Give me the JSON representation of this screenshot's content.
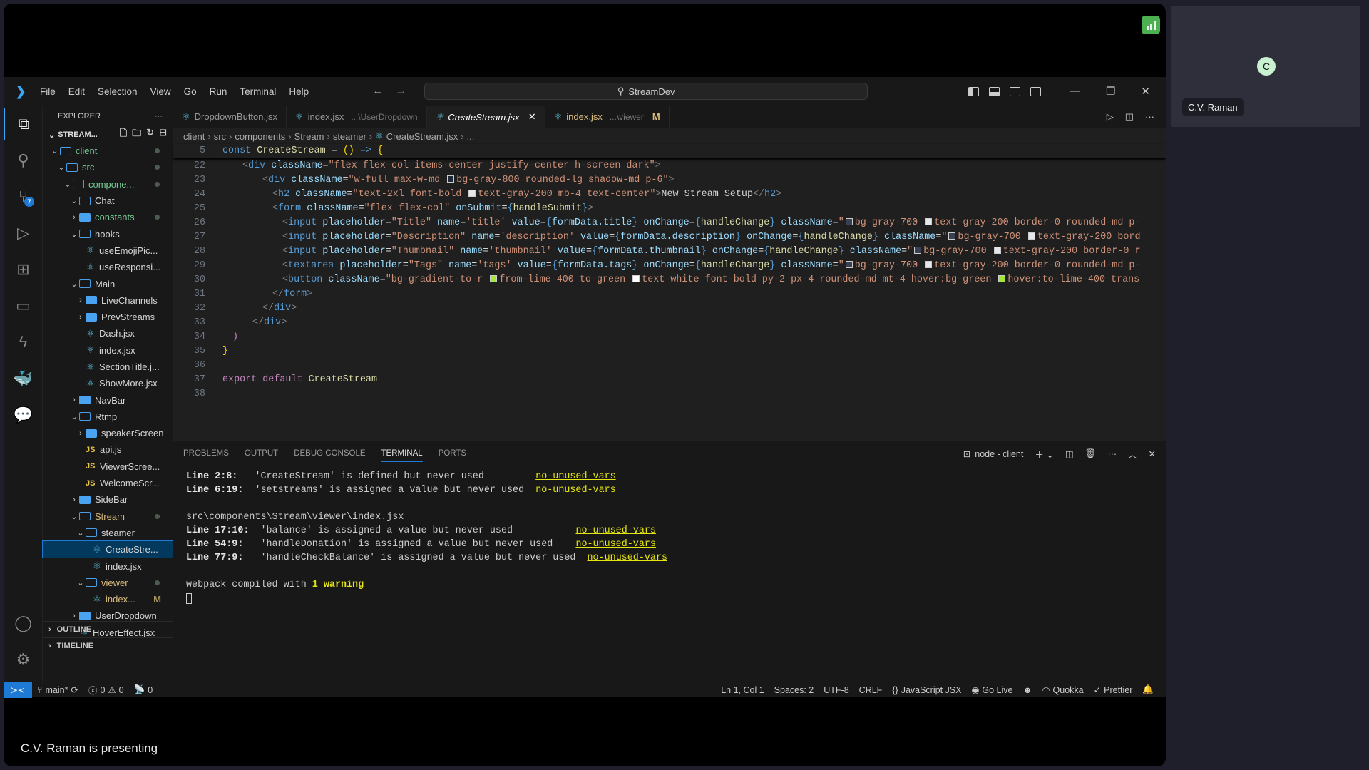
{
  "meeting": {
    "presenter_label": "C.V. Raman is presenting",
    "participant": {
      "initial": "C",
      "name": "C.V. Raman",
      "avatar_color": "#c9f2d0"
    },
    "signal_icon": "signal-bars-icon"
  },
  "titlebar": {
    "menu": [
      "File",
      "Edit",
      "Selection",
      "View",
      "Go",
      "Run",
      "Terminal",
      "Help"
    ],
    "search_text": "StreamDev"
  },
  "activity_bar": {
    "items": [
      "explorer",
      "search",
      "source-control",
      "run-debug",
      "extensions",
      "remote-explorer",
      "thunder-client",
      "docker",
      "live-share-chat"
    ],
    "source_control_badge": "7"
  },
  "sidebar": {
    "title": "EXPLORER",
    "root": "STREAM...",
    "tree": [
      {
        "label": "client",
        "type": "folder-open",
        "depth": 0,
        "color": "green",
        "dot": true
      },
      {
        "label": "src",
        "type": "folder-open",
        "depth": 1,
        "color": "green",
        "dot": true
      },
      {
        "label": "compone...",
        "type": "folder-open",
        "depth": 2,
        "color": "green",
        "dot": true
      },
      {
        "label": "Chat",
        "type": "folder-open",
        "depth": 3,
        "color": "white"
      },
      {
        "label": "constants",
        "type": "folder-closed",
        "depth": 3,
        "color": "green",
        "dot": true
      },
      {
        "label": "hooks",
        "type": "folder-open",
        "depth": 3,
        "color": "white"
      },
      {
        "label": "useEmojiPic...",
        "type": "react",
        "depth": 4,
        "color": "white"
      },
      {
        "label": "useResponsi...",
        "type": "react",
        "depth": 4,
        "color": "white"
      },
      {
        "label": "Main",
        "type": "folder-open",
        "depth": 3,
        "color": "white"
      },
      {
        "label": "LiveChannels",
        "type": "folder-closed",
        "depth": 4,
        "color": "white"
      },
      {
        "label": "PrevStreams",
        "type": "folder-closed",
        "depth": 4,
        "color": "white"
      },
      {
        "label": "Dash.jsx",
        "type": "react",
        "depth": 4,
        "color": "white"
      },
      {
        "label": "index.jsx",
        "type": "react",
        "depth": 4,
        "color": "white"
      },
      {
        "label": "SectionTitle.j...",
        "type": "react",
        "depth": 4,
        "color": "white"
      },
      {
        "label": "ShowMore.jsx",
        "type": "react",
        "depth": 4,
        "color": "white"
      },
      {
        "label": "NavBar",
        "type": "folder-closed",
        "depth": 3,
        "color": "white"
      },
      {
        "label": "Rtmp",
        "type": "folder-open",
        "depth": 3,
        "color": "white"
      },
      {
        "label": "speakerScreen",
        "type": "folder-closed",
        "depth": 4,
        "color": "white"
      },
      {
        "label": "api.js",
        "type": "js",
        "depth": 4,
        "color": "white"
      },
      {
        "label": "ViewerScree...",
        "type": "js",
        "depth": 4,
        "color": "white"
      },
      {
        "label": "WelcomeScr...",
        "type": "js",
        "depth": 4,
        "color": "white"
      },
      {
        "label": "SideBar",
        "type": "folder-closed",
        "depth": 3,
        "color": "white"
      },
      {
        "label": "Stream",
        "type": "folder-open",
        "depth": 3,
        "color": "yellow",
        "dot": true
      },
      {
        "label": "steamer",
        "type": "folder-open",
        "depth": 4,
        "color": "white"
      },
      {
        "label": "CreateStre...",
        "type": "react",
        "depth": 5,
        "color": "white",
        "selected": true
      },
      {
        "label": "index.jsx",
        "type": "react",
        "depth": 5,
        "color": "white"
      },
      {
        "label": "viewer",
        "type": "folder-open",
        "depth": 4,
        "color": "yellow",
        "dot": true
      },
      {
        "label": "index...",
        "type": "react",
        "depth": 5,
        "color": "yellow",
        "badge": "M"
      },
      {
        "label": "UserDropdown",
        "type": "folder-closed",
        "depth": 3,
        "color": "white"
      },
      {
        "label": "HoverEffect.jsx",
        "type": "react",
        "depth": 3,
        "color": "white"
      }
    ],
    "sections": [
      "OUTLINE",
      "TIMELINE"
    ]
  },
  "tabs": [
    {
      "label": "DropdownButton.jsx",
      "desc": "",
      "active": false
    },
    {
      "label": "index.jsx",
      "desc": "...\\UserDropdown",
      "active": false
    },
    {
      "label": "CreateStream.jsx",
      "desc": "",
      "active": true
    },
    {
      "label": "index.jsx",
      "desc": "...\\viewer",
      "active": false,
      "modified": "M"
    }
  ],
  "breadcrumb": [
    "client",
    "src",
    "components",
    "Stream",
    "steamer",
    "CreateStream.jsx",
    "..."
  ],
  "code": {
    "sticky": {
      "num": "5",
      "html": "<span class='kw'>const</span> <span class='fn'>CreateStream</span> <span class='pl'>=</span> <span class='br'>()</span> <span class='kw'>=&gt;</span> <span class='br'>{</span>"
    },
    "lines": [
      {
        "num": "22",
        "indent": 2,
        "html": "<span class='ang'>&lt;</span><span class='tag'>div</span> <span class='attr'>className</span><span class='pl'>=</span><span class='str'>\"flex flex-col items-center justify-center h-screen dark\"</span><span class='ang'>&gt;</span>"
      },
      {
        "num": "23",
        "indent": 4,
        "html": "<span class='ang'>&lt;</span><span class='tag'>div</span> <span class='attr'>className</span><span class='pl'>=</span><span class='str'>\"w-full max-w-md <i class='sw' style='background:#1f2937'></i>bg-gray-800 rounded-lg shadow-md p-6\"</span><span class='ang'>&gt;</span>"
      },
      {
        "num": "24",
        "indent": 5,
        "html": "<span class='ang'>&lt;</span><span class='tag'>h2</span> <span class='attr'>className</span><span class='pl'>=</span><span class='str'>\"text-2xl font-bold <i class='sw' style='background:#e5e7eb'></i>text-gray-200 mb-4 text-center\"</span><span class='ang'>&gt;</span><span class='pl'>New Stream Setup</span><span class='ang'>&lt;/</span><span class='tag'>h2</span><span class='ang'>&gt;</span>"
      },
      {
        "num": "25",
        "indent": 5,
        "html": "<span class='ang'>&lt;</span><span class='tag'>form</span> <span class='attr'>className</span><span class='pl'>=</span><span class='str'>\"flex flex-col\"</span> <span class='attr'>onSubmit</span><span class='pl'>=</span><span class='br' style='color:#569cd6'>{</span><span class='fn'>handleSubmit</span><span class='br' style='color:#569cd6'>}</span><span class='ang'>&gt;</span>"
      },
      {
        "num": "26",
        "indent": 6,
        "html": "<span class='ang'>&lt;</span><span class='tag'>input</span> <span class='attr'>placeholder</span><span class='pl'>=</span><span class='str'>\"Title\"</span> <span class='attr'>name</span><span class='pl'>=</span><span class='str'>'title'</span> <span class='attr'>value</span><span class='pl'>=</span><span class='tag'>{</span><span class='var'>formData.title</span><span class='tag'>}</span> <span class='attr'>onChange</span><span class='pl'>=</span><span class='tag'>{</span><span class='fn'>handleChange</span><span class='tag'>}</span> <span class='attr'>className</span><span class='pl'>=</span><span class='str'>\"<i class='sw' style='background:#374151'></i>bg-gray-700 <i class='sw' style='background:#e5e7eb'></i>text-gray-200 border-0 rounded-md p-</span>"
      },
      {
        "num": "27",
        "indent": 6,
        "html": "<span class='ang'>&lt;</span><span class='tag'>input</span> <span class='attr'>placeholder</span><span class='pl'>=</span><span class='str'>\"Description\"</span> <span class='attr'>name</span><span class='pl'>=</span><span class='str'>'description'</span> <span class='attr'>value</span><span class='pl'>=</span><span class='tag'>{</span><span class='var'>formData.description</span><span class='tag'>}</span> <span class='attr'>onChange</span><span class='pl'>=</span><span class='tag'>{</span><span class='fn'>handleChange</span><span class='tag'>}</span> <span class='attr'>className</span><span class='pl'>=</span><span class='str'>\"<i class='sw' style='background:#374151'></i>bg-gray-700 <i class='sw' style='background:#e5e7eb'></i>text-gray-200 bord</span>"
      },
      {
        "num": "28",
        "indent": 6,
        "html": "<span class='ang'>&lt;</span><span class='tag'>input</span> <span class='attr'>placeholder</span><span class='pl'>=</span><span class='str'>\"Thumbnail\"</span> <span class='attr'>name</span><span class='pl'>=</span><span class='str'>'thumbnail'</span> <span class='attr'>value</span><span class='pl'>=</span><span class='tag'>{</span><span class='var'>formData.thumbnail</span><span class='tag'>}</span> <span class='attr'>onChange</span><span class='pl'>=</span><span class='tag'>{</span><span class='fn'>handleChange</span><span class='tag'>}</span> <span class='attr'>className</span><span class='pl'>=</span><span class='str'>\"<i class='sw' style='background:#374151'></i>bg-gray-700 <i class='sw' style='background:#e5e7eb'></i>text-gray-200 border-0 r</span>"
      },
      {
        "num": "29",
        "indent": 6,
        "html": "<span class='ang'>&lt;</span><span class='tag'>textarea</span> <span class='attr'>placeholder</span><span class='pl'>=</span><span class='str'>\"Tags\"</span> <span class='attr'>name</span><span class='pl'>=</span><span class='str'>'tags'</span> <span class='attr'>value</span><span class='pl'>=</span><span class='tag'>{</span><span class='var'>formData.tags</span><span class='tag'>}</span> <span class='attr'>onChange</span><span class='pl'>=</span><span class='tag'>{</span><span class='fn'>handleChange</span><span class='tag'>}</span> <span class='attr'>className</span><span class='pl'>=</span><span class='str'>\"<i class='sw' style='background:#374151'></i>bg-gray-700 <i class='sw' style='background:#e5e7eb'></i>text-gray-200 border-0 rounded-md p-</span>"
      },
      {
        "num": "30",
        "indent": 6,
        "html": "<span class='ang'>&lt;</span><span class='tag'>button</span> <span class='attr'>className</span><span class='pl'>=</span><span class='str'>\"bg-gradient-to-r <i class='sw' style='background:#a3e635'></i>from-lime-400 to-green <i class='sw' style='background:#fff'></i>text-white font-bold py-2 px-4 rounded-md mt-4 hover:bg-green <i class='sw' style='background:#a3e635'></i>hover:to-lime-400 trans</span>"
      },
      {
        "num": "31",
        "indent": 5,
        "html": "<span class='ang'>&lt;/</span><span class='tag'>form</span><span class='ang'>&gt;</span>"
      },
      {
        "num": "32",
        "indent": 4,
        "html": "<span class='ang'>&lt;/</span><span class='tag'>div</span><span class='ang'>&gt;</span>"
      },
      {
        "num": "33",
        "indent": 3,
        "html": "<span class='ang'>&lt;/</span><span class='tag'>div</span><span class='ang'>&gt;</span>"
      },
      {
        "num": "34",
        "indent": 1,
        "html": "<span class='kw2'>)</span>"
      },
      {
        "num": "35",
        "indent": 0,
        "html": "<span class='br'>}</span>"
      },
      {
        "num": "36",
        "indent": 0,
        "html": ""
      },
      {
        "num": "37",
        "indent": 0,
        "html": "<span class='kw2'>export</span> <span class='kw2'>default</span> <span class='fn'>CreateStream</span>"
      },
      {
        "num": "38",
        "indent": 0,
        "html": ""
      }
    ]
  },
  "panel": {
    "tabs": [
      "PROBLEMS",
      "OUTPUT",
      "DEBUG CONSOLE",
      "TERMINAL",
      "PORTS"
    ],
    "active_tab": "TERMINAL",
    "terminal_name": "node - client",
    "terminal": {
      "block1": [
        {
          "loc": "Line 2:8:",
          "msg": "'CreateStream' is defined but never used       ",
          "rule": "no-unused-vars"
        },
        {
          "loc": "Line 6:19:",
          "msg": "'setstreams' is assigned a value but never used",
          "rule": "no-unused-vars"
        }
      ],
      "file": "src\\components\\Stream\\viewer\\index.jsx",
      "block2": [
        {
          "loc": "Line 17:10:",
          "msg": "'balance' is assigned a value but never used         ",
          "rule": "no-unused-vars"
        },
        {
          "loc": "Line 54:9: ",
          "msg": "'handleDonation' is assigned a value but never used  ",
          "rule": "no-unused-vars"
        },
        {
          "loc": "Line 77:9: ",
          "msg": "'handleCheckBalance' is assigned a value but never used",
          "rule": "no-unused-vars"
        }
      ],
      "compiled_prefix": "webpack compiled with ",
      "compiled_warning": "1 warning"
    }
  },
  "statusbar": {
    "branch": "main*",
    "errors": "0",
    "warnings": "0",
    "ports": "0",
    "cursor": "Ln 1, Col 1",
    "spaces": "Spaces: 2",
    "encoding": "UTF-8",
    "eol": "CRLF",
    "language": "JavaScript JSX",
    "go_live": "Go Live",
    "quokka": "Quokka",
    "prettier": "Prettier"
  }
}
